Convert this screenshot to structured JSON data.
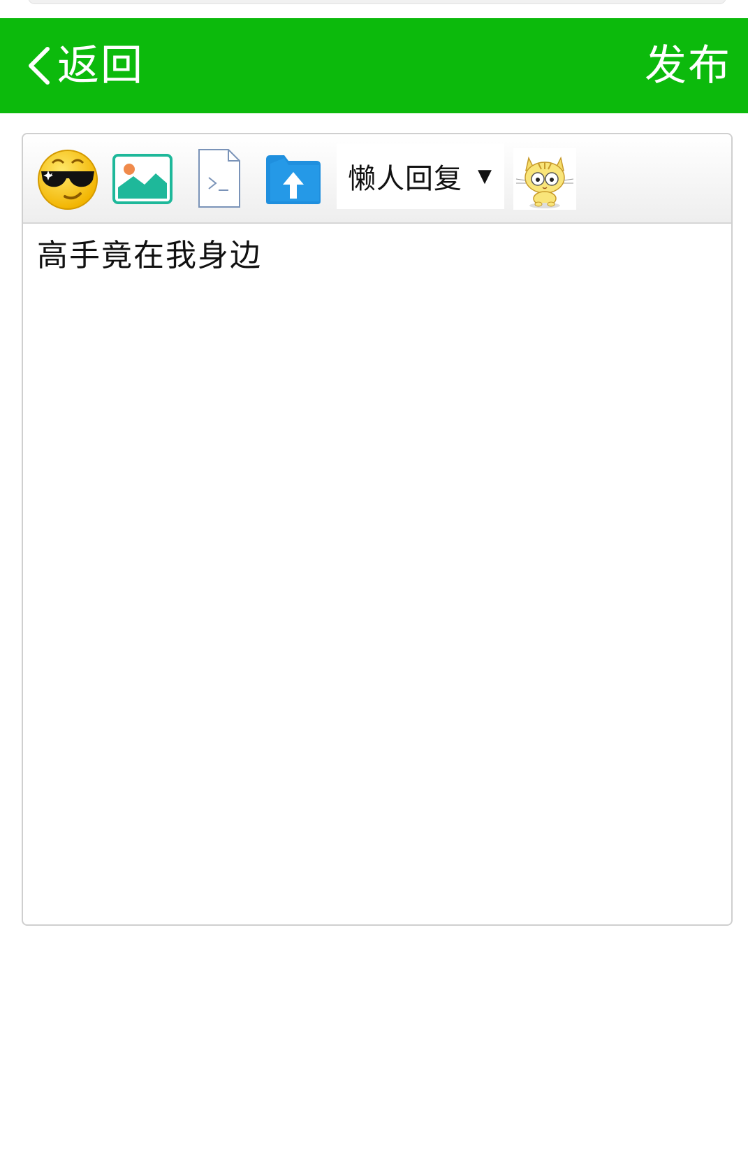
{
  "header": {
    "back_label": "返回",
    "publish_label": "发布",
    "background": "#0cba0c"
  },
  "toolbar": {
    "lazy_reply_label": "懒人回复",
    "lazy_reply_arrow": "▼",
    "icons": [
      "emoji-cool-icon",
      "image-icon",
      "code-file-icon",
      "upload-folder-icon",
      "cat-sticker-icon"
    ]
  },
  "editor": {
    "content": "高手竟在我身边"
  }
}
